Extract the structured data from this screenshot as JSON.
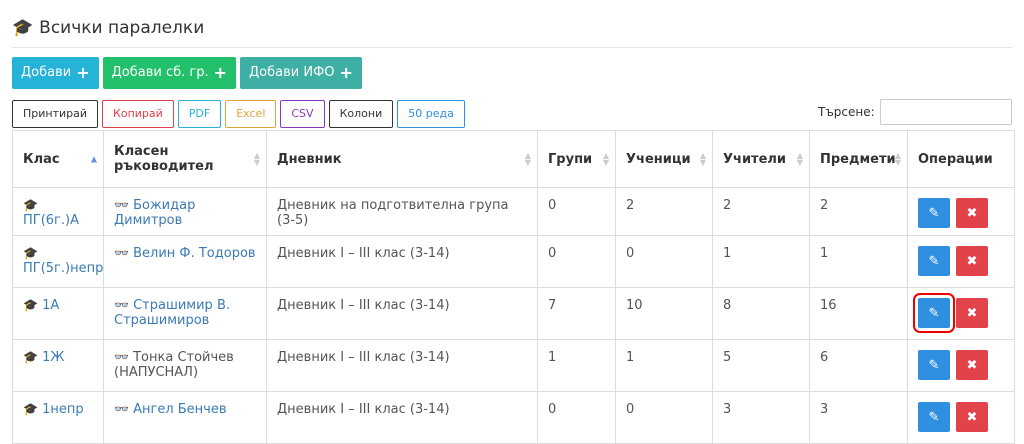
{
  "page": {
    "title": "Всички паралелки"
  },
  "actions": {
    "add": "Добави",
    "add_group": "Добави сб. гр.",
    "add_ifo": "Добави ИФО"
  },
  "tools": [
    "Принтирай",
    "Копирай",
    "PDF",
    "Excel",
    "CSV",
    "Колони",
    "50 реда"
  ],
  "tool_colors": [
    "#333333",
    "#e2424a",
    "#26b3d8",
    "#e0a33a",
    "#8a3ab5",
    "#333333",
    "#2f8fe0"
  ],
  "search": {
    "label": "Търсене:"
  },
  "table": {
    "headers": [
      "Клас",
      "Класен ръководител",
      "Дневник",
      "Групи",
      "Ученици",
      "Учители",
      "Предмети",
      "Операции"
    ],
    "rows": [
      {
        "class": "ПГ(6г.)А",
        "teacher": "Божидар Димитров",
        "diary": "Дневник на подготвителна група (3-5)",
        "groups": "0",
        "students": "2",
        "teachers": "2",
        "subjects": "2"
      },
      {
        "class": "ПГ(5г.)непр",
        "teacher": "Велин Ф. Тодоров",
        "diary": "Дневник I – III клас (3-14)",
        "groups": "0",
        "students": "0",
        "teachers": "1",
        "subjects": "1"
      },
      {
        "class": "1А",
        "teacher": "Страшимир В. Страшимиров",
        "diary": "Дневник I – III клас (3-14)",
        "groups": "7",
        "students": "10",
        "teachers": "8",
        "subjects": "16"
      },
      {
        "class": "1Ж",
        "teacher": "Тонка Стойчев (НАПУСНАЛ)",
        "diary": "Дневник I – III клас (3-14)",
        "groups": "1",
        "students": "1",
        "teachers": "5",
        "subjects": "6"
      },
      {
        "class": "1непр",
        "teacher": "Ангел Бенчев",
        "diary": "Дневник I – III клас (3-14)",
        "groups": "0",
        "students": "0",
        "teachers": "3",
        "subjects": "3"
      }
    ]
  },
  "icons": {
    "grad": "graduation-cap-icon",
    "teacher": "glasses-icon",
    "edit": "edit-icon",
    "delete": "close-icon"
  },
  "colors": {
    "add": "#26b3d8",
    "add_group": "#23c06b",
    "add_ifo": "#3eafa5",
    "edit": "#2f8fe0",
    "delete": "#e2424a",
    "link": "#3a7ab5"
  }
}
